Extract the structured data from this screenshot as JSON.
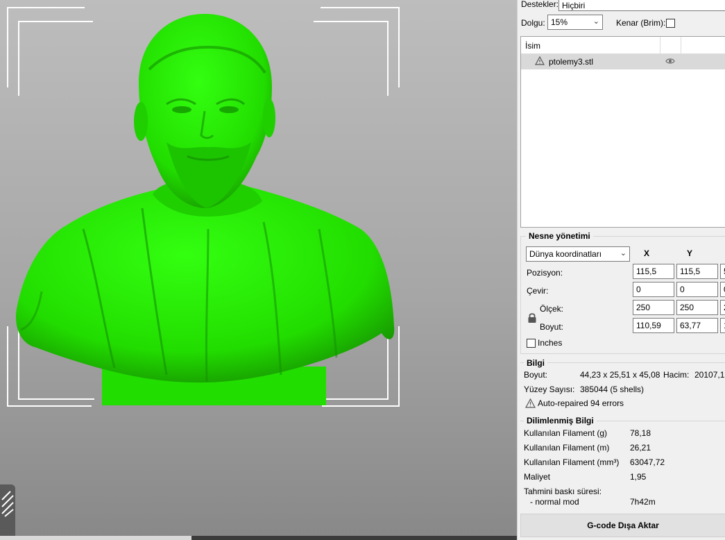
{
  "colors": {
    "model": "#22dd00",
    "viewport_top": "#bdbdbd",
    "viewport_bottom": "#888888",
    "panel_bg": "#f0f0f0",
    "selected_row": "#d9d9d9"
  },
  "settings": {
    "supports_label": "Destekler:",
    "supports_value": "Hiçbiri",
    "infill_label": "Dolgu:",
    "infill_value": "15%",
    "brim_label": "Kenar (Brim):",
    "brim_checked": false
  },
  "object_list": {
    "header": "İsim",
    "items": [
      {
        "name": "ptolemy3.stl",
        "warning_icon": "warning-icon",
        "visibility_icon": "eye-icon"
      }
    ]
  },
  "object_manipulation": {
    "title": "Nesne yönetimi",
    "coord_system": "Dünya koordinatları",
    "col_x": "X",
    "col_y": "Y",
    "rows": [
      {
        "label": "Pozisyon:",
        "x": "115,5",
        "y": "115,5",
        "z": "5"
      },
      {
        "label": "Çevir:",
        "x": "0",
        "y": "0",
        "z": "0"
      },
      {
        "label": "Ölçek:",
        "x": "250",
        "y": "250",
        "z": "2"
      },
      {
        "label": "Boyut:",
        "x": "110,59",
        "y": "63,77",
        "z": "1"
      }
    ],
    "lock_icon": "lock-icon",
    "inches_label": "Inches",
    "inches_checked": false
  },
  "info": {
    "title": "Bilgi",
    "size_label": "Boyut:",
    "size_value": "44,23 x 25,51 x 45,08",
    "volume_label": "Hacim:",
    "volume_value": "20107,1",
    "facets_label": "Yüzey Sayısı:",
    "facets_value": "385044 (5 shells)",
    "repair_text": "Auto-repaired 94 errors"
  },
  "sliced_info": {
    "title": "Dilimlenmiş Bilgi",
    "rows": [
      {
        "label": "Kullanılan Filament (g)",
        "value": "78,18"
      },
      {
        "label": "Kullanılan Filament (m)",
        "value": "26,21"
      },
      {
        "label": "Kullanılan Filament (mm³)",
        "value": "63047,72"
      },
      {
        "label": "Maliyet",
        "value": "1,95"
      }
    ],
    "print_time_label": "Tahmini baskı süresi:",
    "mode_label": "- normal mod",
    "mode_value": "7h42m"
  },
  "export_button": "G-code Dışa Aktar"
}
